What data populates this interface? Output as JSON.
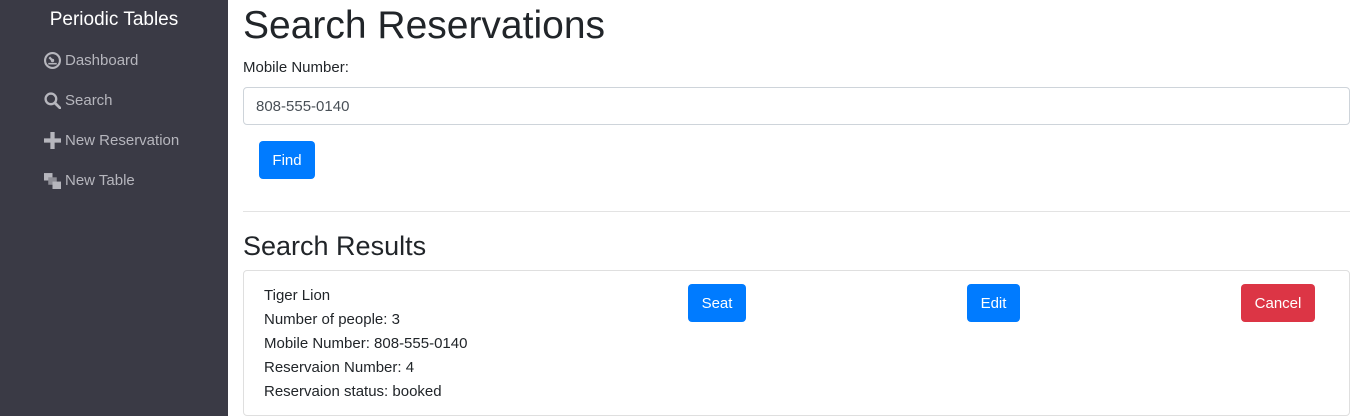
{
  "sidebar": {
    "brand": "Periodic Tables",
    "items": [
      {
        "label": "Dashboard",
        "icon": "dashboard-icon"
      },
      {
        "label": "Search",
        "icon": "search-icon"
      },
      {
        "label": "New Reservation",
        "icon": "plus-icon"
      },
      {
        "label": "New Table",
        "icon": "table-layers-icon"
      }
    ]
  },
  "main": {
    "title": "Search Reservations",
    "mobile_label": "Mobile Number:",
    "mobile_value": "808-555-0140",
    "find_label": "Find",
    "results_title": "Search Results"
  },
  "results": [
    {
      "name": "Tiger Lion",
      "people": "Number of people: 3",
      "mobile": "Mobile Number: 808-555-0140",
      "number": "Reservaion Number: 4",
      "status": "Reservaion status: booked",
      "seat_label": "Seat",
      "edit_label": "Edit",
      "cancel_label": "Cancel"
    }
  ],
  "colors": {
    "sidebar_bg": "#3a3a45",
    "primary": "#007bff",
    "danger": "#dc3545"
  }
}
